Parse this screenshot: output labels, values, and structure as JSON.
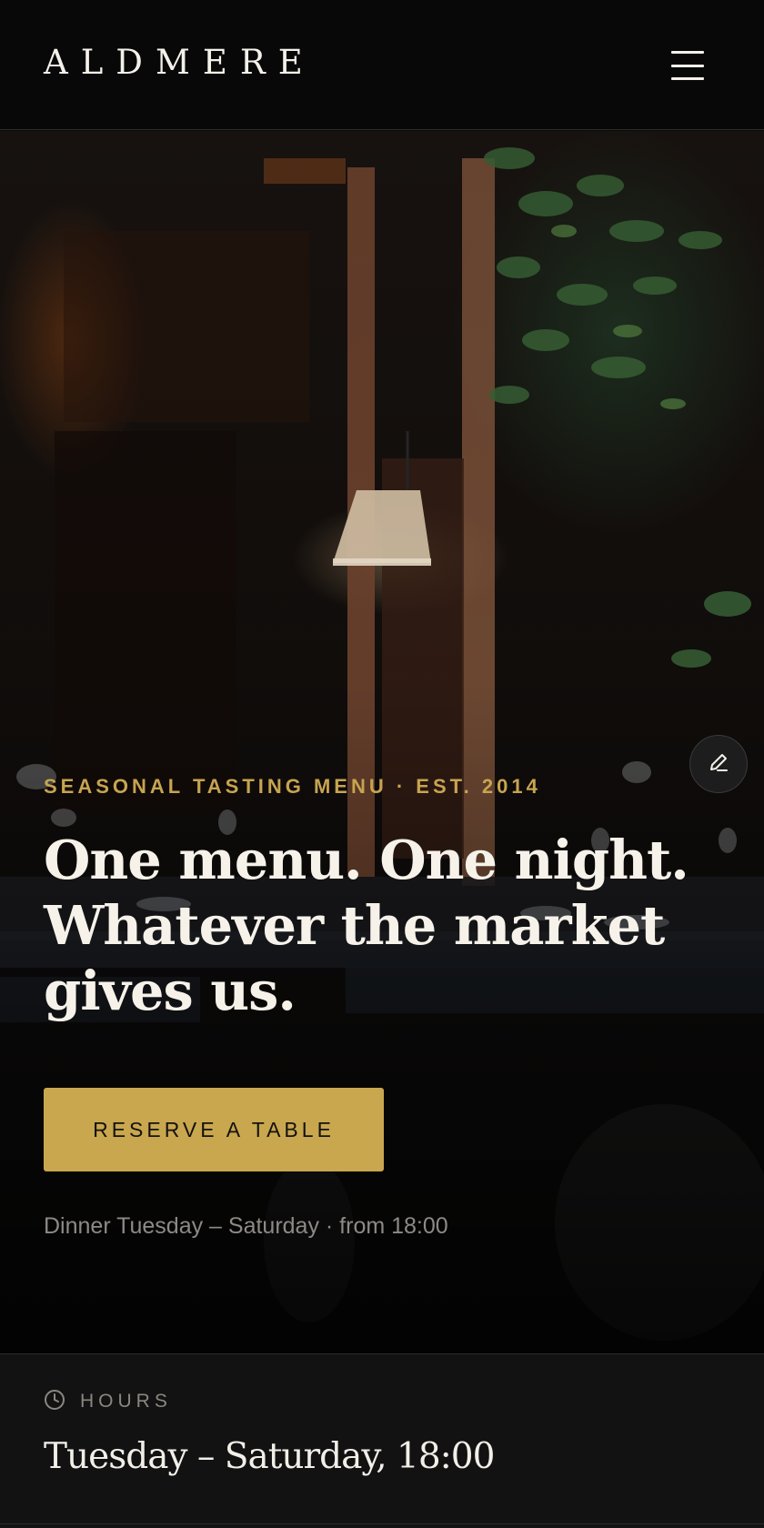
{
  "header": {
    "brand": "ALDMERE",
    "menu_icon": "hamburger-menu-icon"
  },
  "hero": {
    "eyebrow": "SEASONAL TASTING MENU · EST. 2014",
    "headline": "One menu. One night. Whatever the market gives us.",
    "cta_label": "RESERVE A TABLE",
    "note": "Dinner Tuesday – Saturday · from 18:00",
    "edit_icon": "pencil-icon"
  },
  "hours": {
    "label": "HOURS",
    "value": "Tuesday – Saturday, 18:00",
    "icon": "clock-icon"
  },
  "colors": {
    "accent": "#c9a74e",
    "background": "#0b0b0b"
  }
}
